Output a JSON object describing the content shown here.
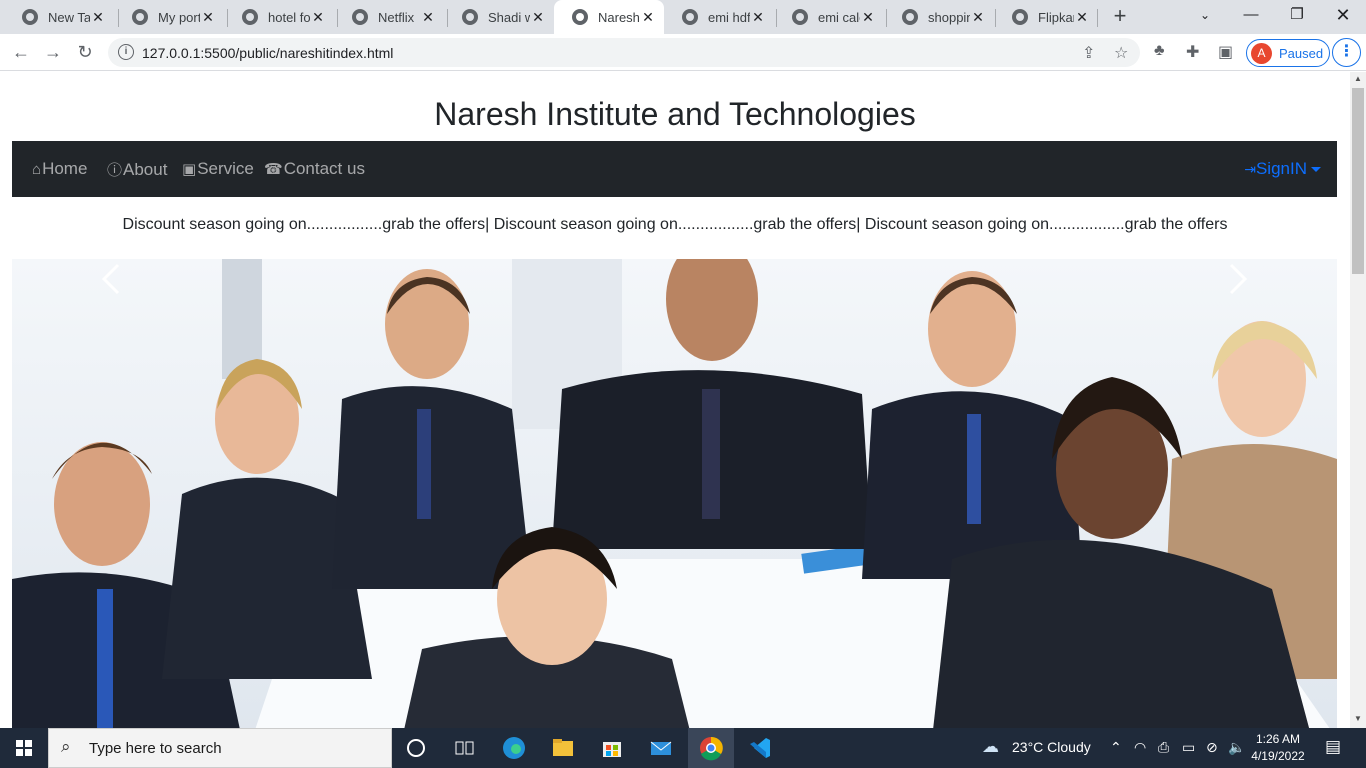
{
  "browser": {
    "tabs": [
      {
        "title": "New Tab",
        "active": false
      },
      {
        "title": "My portfolio",
        "active": false
      },
      {
        "title": "hotel for",
        "active": false
      },
      {
        "title": "Netflix",
        "active": false
      },
      {
        "title": "Shadi website",
        "active": false
      },
      {
        "title": "Naresh Institute",
        "active": true
      },
      {
        "title": "emi hdfc",
        "active": false
      },
      {
        "title": "emi calc",
        "active": false
      },
      {
        "title": "shopping",
        "active": false
      },
      {
        "title": "Flipkart",
        "active": false
      }
    ],
    "url": "127.0.0.1:5500/public/nareshitindex.html",
    "profile_initial": "A",
    "profile_status": "Paused"
  },
  "page": {
    "site_title": "Naresh Institute and Technologies",
    "nav": [
      {
        "label": "Home",
        "icon": "home-icon"
      },
      {
        "label": "About",
        "icon": "question-circle-icon"
      },
      {
        "label": "Service",
        "icon": "person-badge-icon"
      },
      {
        "label": "Contact us",
        "icon": "phone-icon"
      }
    ],
    "signin_label": "SignIN",
    "marquee_text": "Discount season going on.................grab the offers| Discount season going on.................grab the offers| Discount season going on.................grab the offers"
  },
  "taskbar": {
    "search_placeholder": "Type here to search",
    "weather": "23°C  Cloudy",
    "time": "1:26 AM",
    "date": "4/19/2022"
  },
  "colors": {
    "navbar_bg": "#212529",
    "signin_color": "#0d6efd",
    "profile_accent": "#1a73e8"
  }
}
